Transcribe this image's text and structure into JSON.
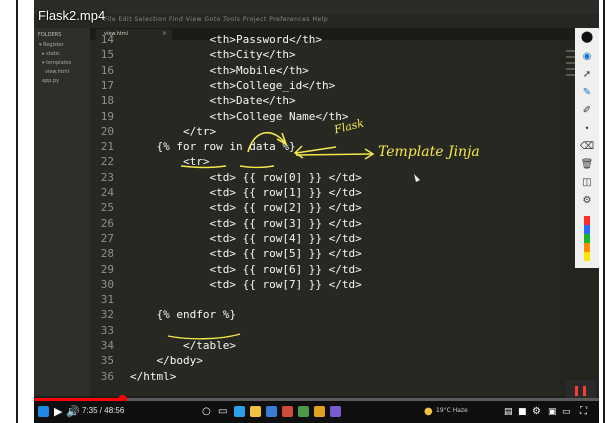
{
  "video": {
    "title": "Flask2.mp4",
    "current_time": "7:35",
    "duration": "48:56",
    "progress": 0.155
  },
  "editor": {
    "menu": "File  Edit  Selection  Find  View  Goto  Tools  Project  Preferences  Help",
    "folders_label": "FOLDERS",
    "sidebar_items": [
      {
        "label": "▾ Register",
        "indent": 1
      },
      {
        "label": "▸ static",
        "indent": 2
      },
      {
        "label": "▾ templates",
        "indent": 2
      },
      {
        "label": "view.html",
        "indent": 3
      },
      {
        "label": "app.py",
        "indent": 2
      }
    ],
    "tab_label": "view.html",
    "tab_close": "×",
    "lines": [
      {
        "num": "14",
        "text": "            <th>Password</th>"
      },
      {
        "num": "15",
        "text": "            <th>City</th>"
      },
      {
        "num": "16",
        "text": "            <th>Mobile</th>"
      },
      {
        "num": "17",
        "text": "            <th>College_id</th>"
      },
      {
        "num": "18",
        "text": "            <th>Date</th>"
      },
      {
        "num": "19",
        "text": "            <th>College Name</th>"
      },
      {
        "num": "20",
        "text": "        </tr>"
      },
      {
        "num": "21",
        "text": "    {% for row in data %}"
      },
      {
        "num": "22",
        "text": "        <tr>"
      },
      {
        "num": "23",
        "text": "            <td> {{ row[0] }} </td>"
      },
      {
        "num": "24",
        "text": "            <td> {{ row[1] }} </td>"
      },
      {
        "num": "25",
        "text": "            <td> {{ row[2] }} </td>"
      },
      {
        "num": "26",
        "text": "            <td> {{ row[3] }} </td>"
      },
      {
        "num": "27",
        "text": "            <td> {{ row[4] }} </td>"
      },
      {
        "num": "28",
        "text": "            <td> {{ row[5] }} </td>"
      },
      {
        "num": "29",
        "text": "            <td> {{ row[6] }} </td>"
      },
      {
        "num": "30",
        "text": "            <td> {{ row[7] }} </td>"
      },
      {
        "num": "31",
        "text": ""
      },
      {
        "num": "32",
        "text": "    {% endfor %}"
      },
      {
        "num": "33",
        "text": ""
      },
      {
        "num": "34",
        "text": "        </table>"
      },
      {
        "num": "35",
        "text": "    </body>"
      },
      {
        "num": "36",
        "text": "</html>"
      }
    ]
  },
  "annotations": {
    "note_1": "Flask",
    "note_2": "Template Jinja"
  },
  "taskbar": {
    "weather": "19°C Haze"
  },
  "colors": {
    "editor_bg": "#272822",
    "annotation": "#f2e84a",
    "seek_fill": "#ff0000"
  }
}
